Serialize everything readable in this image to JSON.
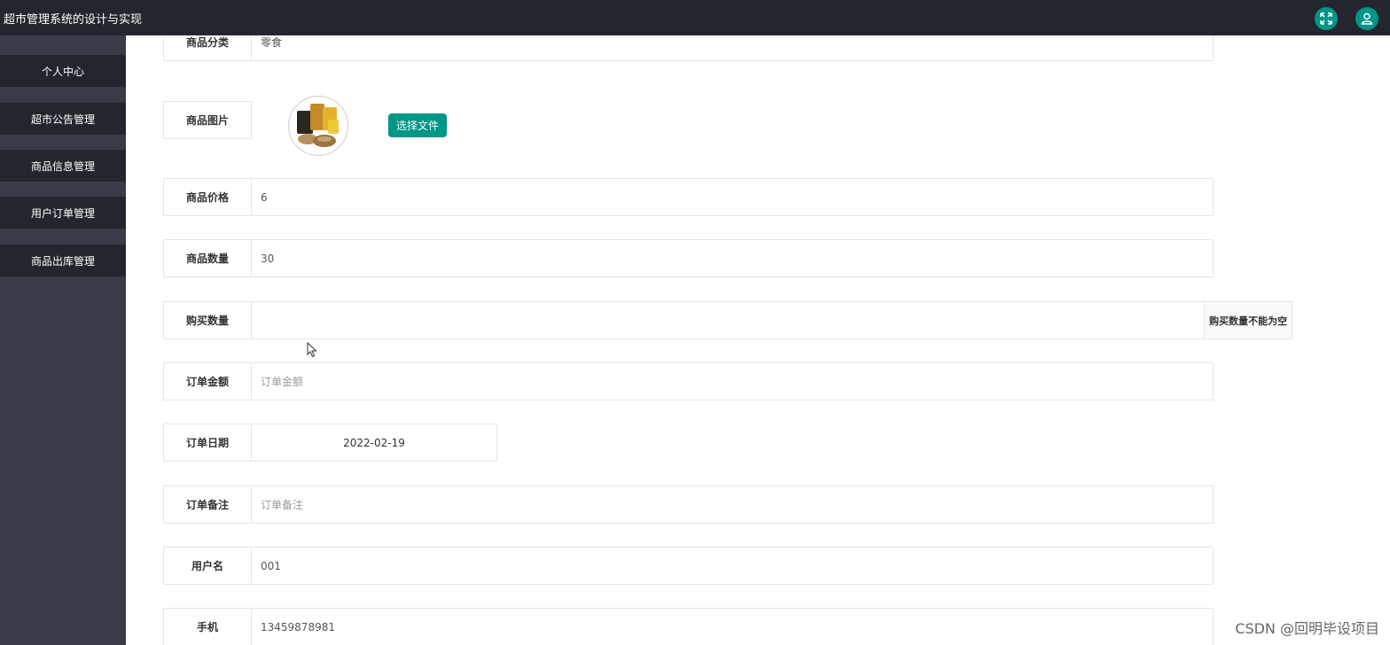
{
  "app": {
    "title": "超市管理系统的设计与实现"
  },
  "sidebar": {
    "items": [
      {
        "label": "个人中心"
      },
      {
        "label": "超市公告管理"
      },
      {
        "label": "商品信息管理"
      },
      {
        "label": "用户订单管理"
      },
      {
        "label": "商品出库管理"
      }
    ]
  },
  "form": {
    "category": {
      "label": "商品分类",
      "value": "零食"
    },
    "image": {
      "label": "商品图片",
      "button": "选择文件"
    },
    "price": {
      "label": "商品价格",
      "value": "6"
    },
    "quantity": {
      "label": "商品数量",
      "value": "30"
    },
    "buy_quantity": {
      "label": "购买数量",
      "value": "",
      "error": "购买数量不能为空"
    },
    "amount": {
      "label": "订单金额",
      "placeholder": "订单金额"
    },
    "date": {
      "label": "订单日期",
      "value": "2022-02-19"
    },
    "remark": {
      "label": "订单备注",
      "placeholder": "订单备注"
    },
    "username": {
      "label": "用户名",
      "value": "001"
    },
    "phone": {
      "label": "手机",
      "value": "13459878981"
    }
  },
  "watermark": "CSDN @回明毕设项目",
  "icons": {
    "fullscreen": "expand-arrows-icon",
    "user": "user-icon"
  },
  "colors": {
    "accent": "#009688",
    "topbar": "#23262e",
    "sidebar": "#383c48"
  }
}
